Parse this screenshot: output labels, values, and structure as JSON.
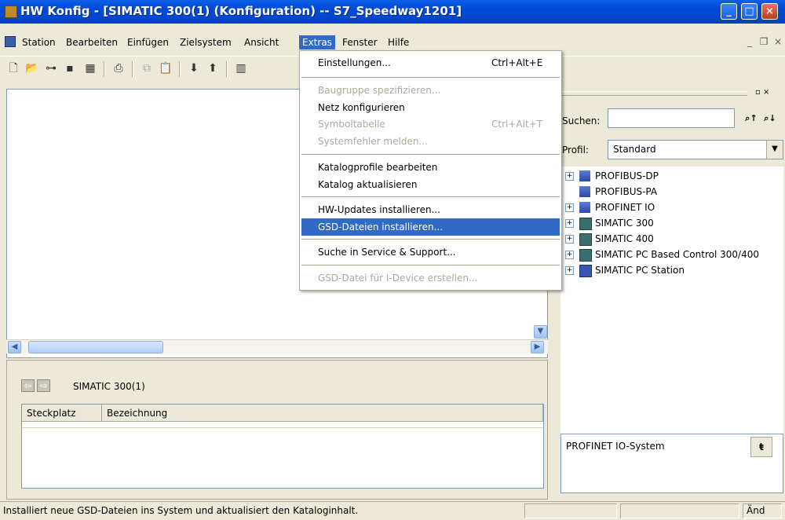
{
  "window": {
    "title": "HW Konfig - [SIMATIC 300(1) (Konfiguration) -- S7_Speedway1201]"
  },
  "menubar": {
    "items": [
      {
        "label": "Station"
      },
      {
        "label": "Bearbeiten"
      },
      {
        "label": "Einfügen"
      },
      {
        "label": "Zielsystem"
      },
      {
        "label": "Ansicht"
      },
      {
        "label": "Extras"
      },
      {
        "label": "Fenster"
      },
      {
        "label": "Hilfe"
      }
    ],
    "active": "Extras"
  },
  "toolbar": {
    "icons": [
      "new-icon",
      "open-icon",
      "network-icon",
      "save-icon",
      "compile-icon",
      "print-icon",
      "copy-icon",
      "paste-icon",
      "download-icon",
      "upload-icon",
      "module-info-icon"
    ]
  },
  "extras_menu": {
    "items": [
      {
        "label": "Einstellungen...",
        "shortcut": "Ctrl+Alt+E",
        "enabled": true
      },
      {
        "label": "Baugruppe spezifizieren...",
        "shortcut": "",
        "enabled": false
      },
      {
        "label": "Netz konfigurieren",
        "shortcut": "",
        "enabled": true
      },
      {
        "label": "Symboltabelle",
        "shortcut": "Ctrl+Alt+T",
        "enabled": false
      },
      {
        "label": "Systemfehler melden...",
        "shortcut": "",
        "enabled": false
      },
      {
        "label": "Katalogprofile bearbeiten",
        "shortcut": "",
        "enabled": true
      },
      {
        "label": "Katalog aktualisieren",
        "shortcut": "",
        "enabled": true
      },
      {
        "label": "HW-Updates installieren...",
        "shortcut": "",
        "enabled": true
      },
      {
        "label": "GSD-Dateien installieren...",
        "shortcut": "",
        "enabled": true,
        "highlighted": true
      },
      {
        "label": "Suche in Service & Support...",
        "shortcut": "",
        "enabled": true
      },
      {
        "label": "GSD-Datei für I-Device erstellen...",
        "shortcut": "",
        "enabled": false
      }
    ]
  },
  "detail": {
    "station_name": "SIMATIC 300(1)",
    "columns": [
      "Steckplatz",
      "Bezeichnung"
    ]
  },
  "catalog": {
    "search_label": "Suchen:",
    "search_value": "",
    "profile_label": "Profil:",
    "profile_value": "Standard",
    "tree": [
      {
        "label": "PROFIBUS-DP",
        "expandable": true,
        "icon": "network-icon"
      },
      {
        "label": "PROFIBUS-PA",
        "expandable": false,
        "icon": "network-icon"
      },
      {
        "label": "PROFINET IO",
        "expandable": true,
        "icon": "network-icon"
      },
      {
        "label": "SIMATIC 300",
        "expandable": true,
        "icon": "rack-icon"
      },
      {
        "label": "SIMATIC 400",
        "expandable": true,
        "icon": "rack-icon"
      },
      {
        "label": "SIMATIC PC Based Control 300/400",
        "expandable": true,
        "icon": "rack-icon"
      },
      {
        "label": "SIMATIC PC Station",
        "expandable": true,
        "icon": "pc-icon"
      }
    ],
    "info_text": "PROFINET IO-System"
  },
  "statusbar": {
    "text": "Installiert neue GSD-Dateien ins System und aktualisiert den Kataloginhalt.",
    "mode": "Änd"
  }
}
